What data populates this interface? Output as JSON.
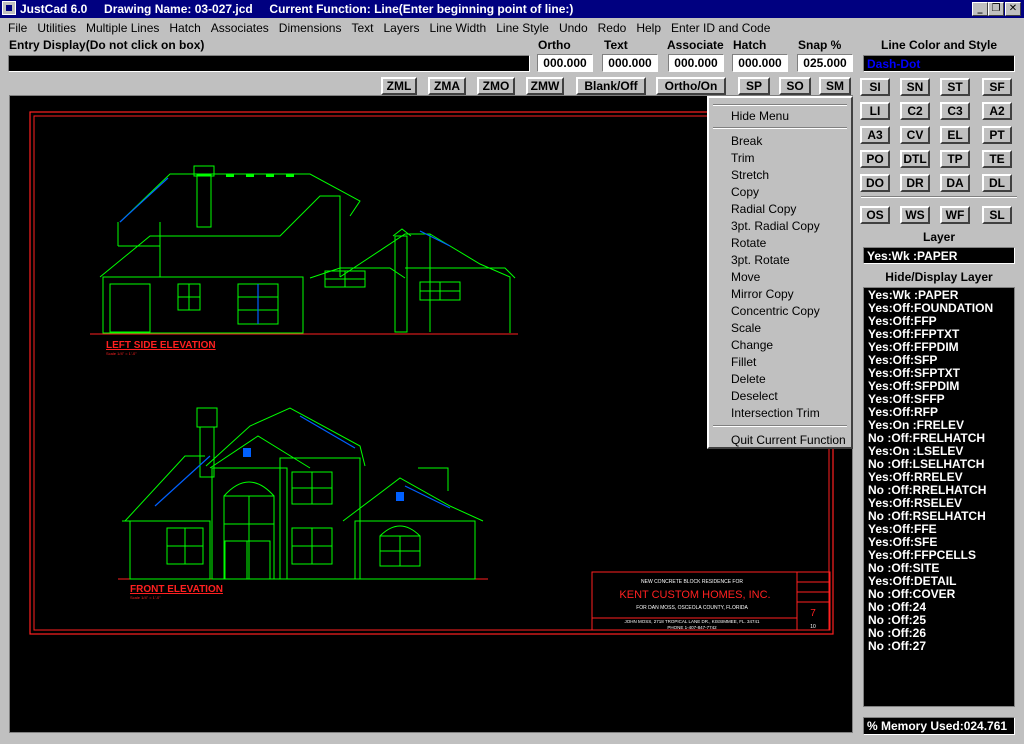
{
  "app": {
    "title": "JustCad 6.0     Drawing Name: 03-027.jcd     Current Function: Line(Enter beginning point of line:)"
  },
  "window_buttons": {
    "minimize": "_",
    "restore": "❐",
    "close": "✕"
  },
  "menu": [
    "File",
    "Utilities",
    "Multiple Lines",
    "Hatch",
    "Associates",
    "Dimensions",
    "Text",
    "Layers",
    "Line Width",
    "Line Style",
    "Undo",
    "Redo",
    "Help",
    "Enter ID and Code"
  ],
  "entry": {
    "label": "Entry Display(Do not click on box)",
    "value": ""
  },
  "fields": [
    {
      "label": "Ortho",
      "value": "000.000"
    },
    {
      "label": "Text",
      "value": "000.000"
    },
    {
      "label": "Associate",
      "value": "000.000"
    },
    {
      "label": "Hatch",
      "value": "000.000"
    },
    {
      "label": "Snap %",
      "value": "025.000"
    }
  ],
  "toolbar": [
    "ZML",
    "ZMA",
    "ZMO",
    "ZMW",
    "Blank/Off",
    "Ortho/On",
    "SP",
    "SO",
    "SM"
  ],
  "line_color": {
    "label": "Line Color and Style",
    "value": "Dash-Dot",
    "color": "#0000ff"
  },
  "snap_buttons": [
    [
      "SI",
      "SN",
      "ST",
      "SF"
    ],
    [
      "LI",
      "C2",
      "C3",
      "A2"
    ],
    [
      "A3",
      "CV",
      "EL",
      "PT"
    ],
    [
      "PO",
      "DTL",
      "TP",
      "TE"
    ],
    [
      "DO",
      "DR",
      "DA",
      "DL"
    ],
    [
      "OS",
      "WS",
      "WF",
      "SL"
    ]
  ],
  "layer": {
    "label": "Layer",
    "value": "Yes:Wk :PAPER"
  },
  "hide_display": {
    "label": "Hide/Display Layer",
    "items": [
      "Yes:Wk :PAPER",
      "Yes:Off:FOUNDATION",
      "Yes:Off:FFP",
      "Yes:Off:FFPTXT",
      "Yes:Off:FFPDIM",
      "Yes:Off:SFP",
      "Yes:Off:SFPTXT",
      "Yes:Off:SFPDIM",
      "Yes:Off:SFFP",
      "Yes:Off:RFP",
      "Yes:On :FRELEV",
      "No :Off:FRELHATCH",
      "Yes:On :LSELEV",
      "No :Off:LSELHATCH",
      "Yes:Off:RRELEV",
      "No :Off:RRELHATCH",
      "Yes:Off:RSELEV",
      "No :Off:RSELHATCH",
      "Yes:Off:FFE",
      "Yes:Off:SFE",
      "Yes:Off:FFPCELLS",
      "No :Off:SITE",
      "Yes:Off:DETAIL",
      "No :Off:COVER",
      "No :Off:24",
      "No :Off:25",
      "No :Off:26",
      "No :Off:27"
    ]
  },
  "memory": "% Memory Used:024.761",
  "context_menu": {
    "hide": "Hide Menu",
    "items": [
      "Break",
      "Trim",
      "Stretch",
      "Copy",
      "Radial Copy",
      "3pt. Radial Copy",
      "Rotate",
      "3pt. Rotate",
      "Move",
      "Mirror Copy",
      "Concentric Copy",
      "Scale",
      "Change",
      "Fillet",
      "Delete",
      "Deselect",
      "Intersection Trim"
    ],
    "quit": "Quit Current Function"
  },
  "drawing": {
    "left_title": "LEFT SIDE ELEVATION",
    "left_scale": "Scale 1/4\" = 1'-0\"",
    "front_title": "FRONT ELEVATION",
    "front_scale": "Scale 1/4\" = 1'-0\"",
    "title_block": {
      "line1": "NEW CONCRETE BLOCK RESIDENCE FOR",
      "company": "KENT CUSTOM HOMES, INC.",
      "line3": "FOR DAN MOSS, OSCEOLA COUNTY, FLORIDA",
      "line4": "JOHN MOSS, 2718 TROPICAL LANE DR., KISSIMMEE, FL. 34741",
      "line5": "PHONE 1-407-847-7742",
      "sheet_no": "7",
      "sheet_of": "10"
    },
    "colors": {
      "frame": "#ff2020",
      "line": "#00ff00",
      "accent": "#0060ff",
      "title_text": "#ff2020",
      "info_text": "#ffffff"
    }
  }
}
